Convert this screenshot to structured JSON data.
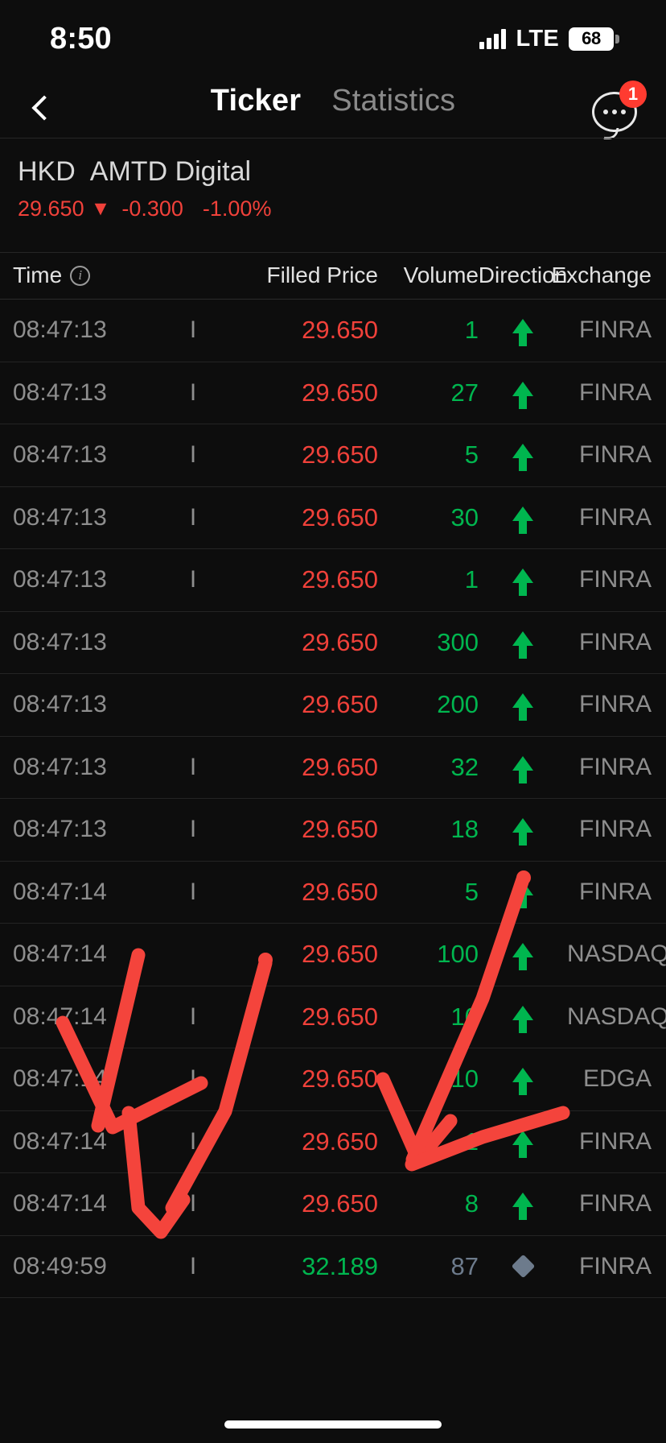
{
  "status_bar": {
    "time": "8:50",
    "network": "LTE",
    "battery_level": "68",
    "signal_icon": "signal-bars-icon"
  },
  "nav": {
    "back_icon": "chevron-left-icon",
    "tab_active": "Ticker",
    "tab_inactive": "Statistics",
    "chat_icon": "chat-bubble-ellipsis-icon",
    "badge_count": "1"
  },
  "ticker": {
    "market": "HKD",
    "name": "AMTD Digital",
    "price": "29.650",
    "trend_arrow": "▼",
    "change": "-0.300",
    "change_percent": "-1.00%",
    "down_color": "#f0413a",
    "up_color": "#00b64f"
  },
  "table": {
    "headers": {
      "time": "Time",
      "time_info_icon": "info-circle-icon",
      "filled_price": "Filled Price",
      "volume": "Volume",
      "direction": "Direction",
      "exchange": "Exchange"
    },
    "rows": [
      {
        "time": "08:47:13",
        "cond": "I",
        "price": "29.650",
        "price_dir": "down",
        "volume": "1",
        "vol_state": "up",
        "direction": "up",
        "exchange": "FINRA"
      },
      {
        "time": "08:47:13",
        "cond": "I",
        "price": "29.650",
        "price_dir": "down",
        "volume": "27",
        "vol_state": "up",
        "direction": "up",
        "exchange": "FINRA"
      },
      {
        "time": "08:47:13",
        "cond": "I",
        "price": "29.650",
        "price_dir": "down",
        "volume": "5",
        "vol_state": "up",
        "direction": "up",
        "exchange": "FINRA"
      },
      {
        "time": "08:47:13",
        "cond": "I",
        "price": "29.650",
        "price_dir": "down",
        "volume": "30",
        "vol_state": "up",
        "direction": "up",
        "exchange": "FINRA"
      },
      {
        "time": "08:47:13",
        "cond": "I",
        "price": "29.650",
        "price_dir": "down",
        "volume": "1",
        "vol_state": "up",
        "direction": "up",
        "exchange": "FINRA"
      },
      {
        "time": "08:47:13",
        "cond": "",
        "price": "29.650",
        "price_dir": "down",
        "volume": "300",
        "vol_state": "up",
        "direction": "up",
        "exchange": "FINRA"
      },
      {
        "time": "08:47:13",
        "cond": "",
        "price": "29.650",
        "price_dir": "down",
        "volume": "200",
        "vol_state": "up",
        "direction": "up",
        "exchange": "FINRA"
      },
      {
        "time": "08:47:13",
        "cond": "I",
        "price": "29.650",
        "price_dir": "down",
        "volume": "32",
        "vol_state": "up",
        "direction": "up",
        "exchange": "FINRA"
      },
      {
        "time": "08:47:13",
        "cond": "I",
        "price": "29.650",
        "price_dir": "down",
        "volume": "18",
        "vol_state": "up",
        "direction": "up",
        "exchange": "FINRA"
      },
      {
        "time": "08:47:14",
        "cond": "I",
        "price": "29.650",
        "price_dir": "down",
        "volume": "5",
        "vol_state": "up",
        "direction": "up",
        "exchange": "FINRA"
      },
      {
        "time": "08:47:14",
        "cond": "",
        "price": "29.650",
        "price_dir": "down",
        "volume": "100",
        "vol_state": "up",
        "direction": "up",
        "exchange": "NASDAQ"
      },
      {
        "time": "08:47:14",
        "cond": "I",
        "price": "29.650",
        "price_dir": "down",
        "volume": "10",
        "vol_state": "up",
        "direction": "up",
        "exchange": "NASDAQ"
      },
      {
        "time": "08:47:14",
        "cond": "I",
        "price": "29.650",
        "price_dir": "down",
        "volume": "10",
        "vol_state": "up",
        "direction": "up",
        "exchange": "EDGA"
      },
      {
        "time": "08:47:14",
        "cond": "I",
        "price": "29.650",
        "price_dir": "down",
        "volume": "1",
        "vol_state": "up",
        "direction": "up",
        "exchange": "FINRA"
      },
      {
        "time": "08:47:14",
        "cond": "I",
        "price": "29.650",
        "price_dir": "down",
        "volume": "8",
        "vol_state": "up",
        "direction": "up",
        "exchange": "FINRA"
      },
      {
        "time": "08:49:59",
        "cond": "I",
        "price": "32.189",
        "price_dir": "up",
        "volume": "87",
        "vol_state": "neutral",
        "direction": "neutral",
        "exchange": "FINRA"
      }
    ]
  },
  "annotation": {
    "type": "handwritten-marks",
    "color": "#f4443c",
    "description": "red hand-drawn check marks over lower table rows"
  },
  "home_indicator": "home-indicator-bar"
}
